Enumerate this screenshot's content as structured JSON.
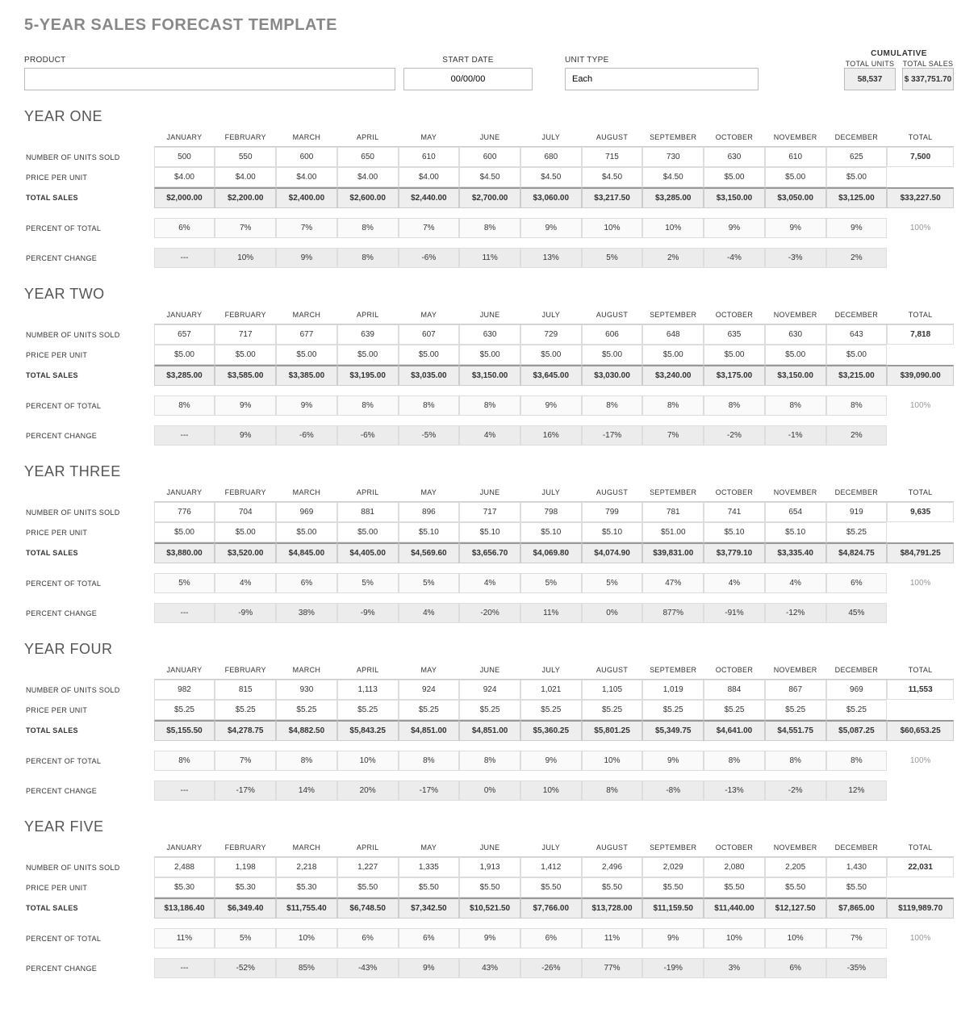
{
  "title": "5-YEAR SALES FORECAST TEMPLATE",
  "header": {
    "product_label": "PRODUCT",
    "product_value": "",
    "start_date_label": "START DATE",
    "start_date_value": "00/00/00",
    "unit_type_label": "UNIT TYPE",
    "unit_type_value": "Each",
    "cumulative_label": "CUMULATIVE",
    "total_units_label": "TOTAL UNITS",
    "total_units_value": "58,537",
    "total_sales_label": "TOTAL SALES",
    "total_sales_value": "$ 337,751.70"
  },
  "months": [
    "JANUARY",
    "FEBRUARY",
    "MARCH",
    "APRIL",
    "MAY",
    "JUNE",
    "JULY",
    "AUGUST",
    "SEPTEMBER",
    "OCTOBER",
    "NOVEMBER",
    "DECEMBER",
    "TOTAL"
  ],
  "row_labels": {
    "units": "NUMBER OF UNITS SOLD",
    "price": "PRICE PER UNIT",
    "sales": "TOTAL SALES",
    "pct_total": "PERCENT OF TOTAL",
    "pct_change": "PERCENT CHANGE"
  },
  "years": [
    {
      "title": "YEAR ONE",
      "units": [
        "500",
        "550",
        "600",
        "650",
        "610",
        "600",
        "680",
        "715",
        "730",
        "630",
        "610",
        "625",
        "7,500"
      ],
      "price": [
        "$4.00",
        "$4.00",
        "$4.00",
        "$4.00",
        "$4.00",
        "$4.50",
        "$4.50",
        "$4.50",
        "$4.50",
        "$5.00",
        "$5.00",
        "$5.00",
        ""
      ],
      "sales": [
        "$2,000.00",
        "$2,200.00",
        "$2,400.00",
        "$2,600.00",
        "$2,440.00",
        "$2,700.00",
        "$3,060.00",
        "$3,217.50",
        "$3,285.00",
        "$3,150.00",
        "$3,050.00",
        "$3,125.00",
        "$33,227.50"
      ],
      "pct_total": [
        "6%",
        "7%",
        "7%",
        "8%",
        "7%",
        "8%",
        "9%",
        "10%",
        "10%",
        "9%",
        "9%",
        "9%",
        "100%"
      ],
      "pct_change": [
        "---",
        "10%",
        "9%",
        "8%",
        "-6%",
        "11%",
        "13%",
        "5%",
        "2%",
        "-4%",
        "-3%",
        "2%",
        ""
      ]
    },
    {
      "title": "YEAR TWO",
      "units": [
        "657",
        "717",
        "677",
        "639",
        "607",
        "630",
        "729",
        "606",
        "648",
        "635",
        "630",
        "643",
        "7,818"
      ],
      "price": [
        "$5.00",
        "$5.00",
        "$5.00",
        "$5.00",
        "$5.00",
        "$5.00",
        "$5.00",
        "$5.00",
        "$5.00",
        "$5.00",
        "$5.00",
        "$5.00",
        ""
      ],
      "sales": [
        "$3,285.00",
        "$3,585.00",
        "$3,385.00",
        "$3,195.00",
        "$3,035.00",
        "$3,150.00",
        "$3,645.00",
        "$3,030.00",
        "$3,240.00",
        "$3,175.00",
        "$3,150.00",
        "$3,215.00",
        "$39,090.00"
      ],
      "pct_total": [
        "8%",
        "9%",
        "9%",
        "8%",
        "8%",
        "8%",
        "9%",
        "8%",
        "8%",
        "8%",
        "8%",
        "8%",
        "100%"
      ],
      "pct_change": [
        "---",
        "9%",
        "-6%",
        "-6%",
        "-5%",
        "4%",
        "16%",
        "-17%",
        "7%",
        "-2%",
        "-1%",
        "2%",
        ""
      ]
    },
    {
      "title": "YEAR THREE",
      "units": [
        "776",
        "704",
        "969",
        "881",
        "896",
        "717",
        "798",
        "799",
        "781",
        "741",
        "654",
        "919",
        "9,635"
      ],
      "price": [
        "$5.00",
        "$5.00",
        "$5.00",
        "$5.00",
        "$5.10",
        "$5.10",
        "$5.10",
        "$5.10",
        "$51.00",
        "$5.10",
        "$5.10",
        "$5.25",
        ""
      ],
      "sales": [
        "$3,880.00",
        "$3,520.00",
        "$4,845.00",
        "$4,405.00",
        "$4,569.60",
        "$3,656.70",
        "$4,069.80",
        "$4,074.90",
        "$39,831.00",
        "$3,779.10",
        "$3,335.40",
        "$4,824.75",
        "$84,791.25"
      ],
      "pct_total": [
        "5%",
        "4%",
        "6%",
        "5%",
        "5%",
        "4%",
        "5%",
        "5%",
        "47%",
        "4%",
        "4%",
        "6%",
        "100%"
      ],
      "pct_change": [
        "---",
        "-9%",
        "38%",
        "-9%",
        "4%",
        "-20%",
        "11%",
        "0%",
        "877%",
        "-91%",
        "-12%",
        "45%",
        ""
      ]
    },
    {
      "title": "YEAR FOUR",
      "units": [
        "982",
        "815",
        "930",
        "1,113",
        "924",
        "924",
        "1,021",
        "1,105",
        "1,019",
        "884",
        "867",
        "969",
        "11,553"
      ],
      "price": [
        "$5.25",
        "$5.25",
        "$5.25",
        "$5.25",
        "$5.25",
        "$5.25",
        "$5.25",
        "$5.25",
        "$5.25",
        "$5.25",
        "$5.25",
        "$5.25",
        ""
      ],
      "sales": [
        "$5,155.50",
        "$4,278.75",
        "$4,882.50",
        "$5,843.25",
        "$4,851.00",
        "$4,851.00",
        "$5,360.25",
        "$5,801.25",
        "$5,349.75",
        "$4,641.00",
        "$4,551.75",
        "$5,087.25",
        "$60,653.25"
      ],
      "pct_total": [
        "8%",
        "7%",
        "8%",
        "10%",
        "8%",
        "8%",
        "9%",
        "10%",
        "9%",
        "8%",
        "8%",
        "8%",
        "100%"
      ],
      "pct_change": [
        "---",
        "-17%",
        "14%",
        "20%",
        "-17%",
        "0%",
        "10%",
        "8%",
        "-8%",
        "-13%",
        "-2%",
        "12%",
        ""
      ]
    },
    {
      "title": "YEAR FIVE",
      "units": [
        "2,488",
        "1,198",
        "2,218",
        "1,227",
        "1,335",
        "1,913",
        "1,412",
        "2,496",
        "2,029",
        "2,080",
        "2,205",
        "1,430",
        "22,031"
      ],
      "price": [
        "$5.30",
        "$5.30",
        "$5.30",
        "$5.50",
        "$5.50",
        "$5.50",
        "$5.50",
        "$5.50",
        "$5.50",
        "$5.50",
        "$5.50",
        "$5.50",
        ""
      ],
      "sales": [
        "$13,186.40",
        "$6,349.40",
        "$11,755.40",
        "$6,748.50",
        "$7,342.50",
        "$10,521.50",
        "$7,766.00",
        "$13,728.00",
        "$11,159.50",
        "$11,440.00",
        "$12,127.50",
        "$7,865.00",
        "$119,989.70"
      ],
      "pct_total": [
        "11%",
        "5%",
        "10%",
        "6%",
        "6%",
        "9%",
        "6%",
        "11%",
        "9%",
        "10%",
        "10%",
        "7%",
        "100%"
      ],
      "pct_change": [
        "---",
        "-52%",
        "85%",
        "-43%",
        "9%",
        "43%",
        "-26%",
        "77%",
        "-19%",
        "3%",
        "6%",
        "-35%",
        ""
      ]
    }
  ]
}
